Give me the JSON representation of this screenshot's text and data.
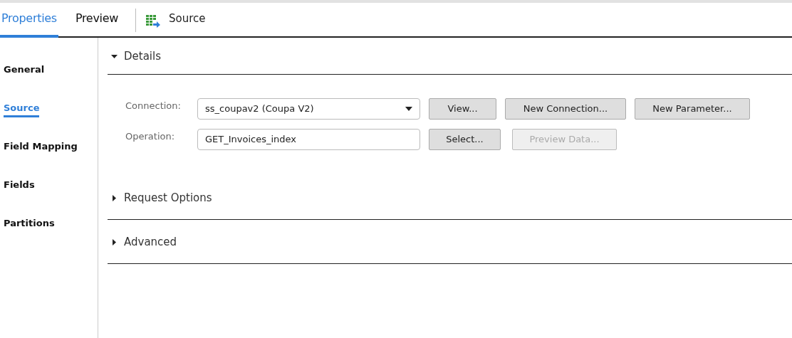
{
  "tabs": [
    {
      "label": "Properties",
      "selected": true
    },
    {
      "label": "Preview",
      "selected": false
    }
  ],
  "object_title": "Source",
  "sidebar": {
    "items": [
      {
        "label": "General",
        "selected": false
      },
      {
        "label": "Source",
        "selected": true
      },
      {
        "label": "Field Mapping",
        "selected": false
      },
      {
        "label": "Fields",
        "selected": false
      },
      {
        "label": "Partitions",
        "selected": false
      }
    ]
  },
  "sections": [
    {
      "title": "Details",
      "expanded": true,
      "rows": [
        {
          "label": "Connection:",
          "field": {
            "kind": "dropdown",
            "value": "ss_coupav2 (Coupa V2)"
          },
          "buttons": [
            {
              "label": "View...",
              "disabled": false
            },
            {
              "label": "New Connection...",
              "disabled": false
            },
            {
              "label": "New Parameter...",
              "disabled": false
            }
          ]
        },
        {
          "label": "Operation:",
          "field": {
            "kind": "text",
            "value": "GET_Invoices_index"
          },
          "buttons": [
            {
              "label": "Select...",
              "disabled": false
            },
            {
              "label": "Preview Data...",
              "disabled": true
            }
          ]
        }
      ]
    },
    {
      "title": "Request Options",
      "expanded": false
    },
    {
      "title": "Advanced",
      "expanded": false
    }
  ]
}
